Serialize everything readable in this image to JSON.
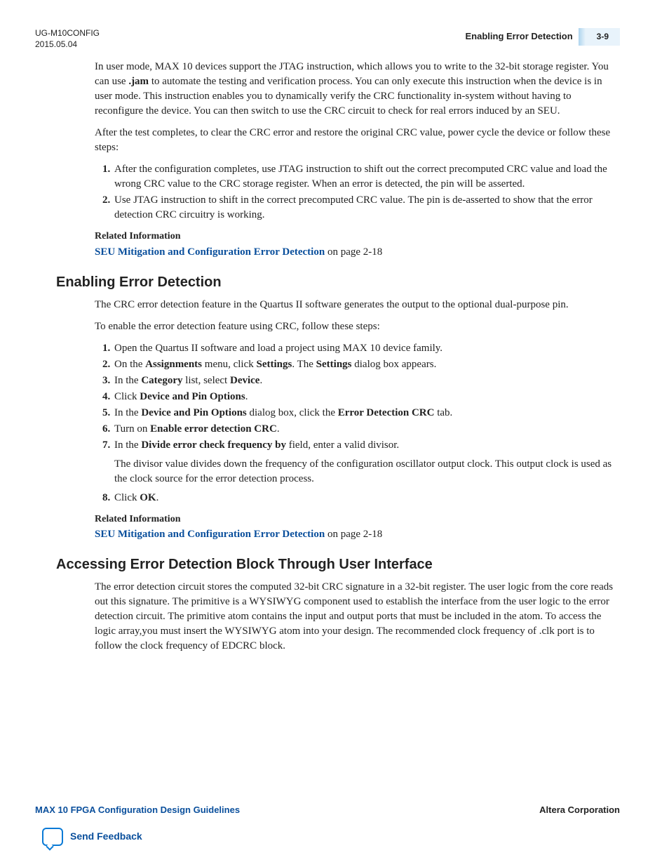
{
  "header": {
    "doc_id": "UG-M10CONFIG",
    "date": "2015.05.04",
    "page_title": "Enabling Error Detection",
    "page_number": "3-9"
  },
  "intro_para": "In user mode, MAX 10 devices support the                                   JTAG instruction, which allows you to write to the 32-bit storage register. You can use ",
  "intro_bold": ".jam",
  "intro_after": " to automate the testing and verification process. You can only execute this instruction when the device is in user mode. This instruction enables you to dynamically verify the CRC functionality in-system without having to reconfigure the device. You can then switch to use the CRC circuit to check for real errors induced by an SEU.",
  "para2": "After the test completes, to clear the CRC error and restore the original CRC value, power cycle the device or follow these steps:",
  "steps1": [
    "After the configuration completes, use                                    JTAG instruction to shift out the correct precomputed CRC value and load the wrong CRC value to the CRC storage register. When an error is detected, the                      pin will be asserted.",
    "Use                           JTAG instruction to shift in the correct precomputed CRC value. The                      pin is de-asserted to show that the error detection CRC circuitry is working."
  ],
  "related1": {
    "heading": "Related Information",
    "link": "SEU Mitigation and Configuration Error Detection",
    "suffix": " on page 2-18"
  },
  "section1": {
    "title": "Enabling Error Detection",
    "p1": "The CRC error detection feature in the Quartus II software generates the                         output to the optional dual-purpose                       pin.",
    "p2": "To enable the error detection feature using CRC, follow these steps:",
    "steps_text": {
      "s1": "Open the Quartus II software and load a project using MAX 10 device family.",
      "s2_a": "On the ",
      "s2_b": "Assignments",
      "s2_c": " menu, click ",
      "s2_d": "Settings",
      "s2_e": ". The ",
      "s2_f": "Settings",
      "s2_g": " dialog box appears.",
      "s3_a": "In the ",
      "s3_b": "Category",
      "s3_c": " list, select ",
      "s3_d": "Device",
      "s3_e": ".",
      "s4_a": "Click ",
      "s4_b": "Device and Pin Options",
      "s4_c": ".",
      "s5_a": "In the ",
      "s5_b": "Device and Pin Options",
      "s5_c": " dialog box, click the ",
      "s5_d": "Error Detection CRC",
      "s5_e": " tab.",
      "s6_a": "Turn on ",
      "s6_b": "Enable error detection CRC",
      "s6_c": ".",
      "s7_a": "In the ",
      "s7_b": "Divide error check frequency by",
      "s7_c": " field, enter a valid divisor.",
      "s7_note": "The divisor value divides down the frequency of the configuration oscillator output clock. This output clock is used as the clock source for the error detection process.",
      "s8_a": "Click ",
      "s8_b": "OK",
      "s8_c": "."
    }
  },
  "related2": {
    "heading": "Related Information",
    "link": "SEU Mitigation and Configuration Error Detection",
    "suffix": " on page 2-18"
  },
  "section2": {
    "title": "Accessing Error Detection Block Through User Interface",
    "p1": "The error detection circuit stores the computed 32-bit CRC signature in a 32-bit register. The user logic from the core reads out this signature. The                                              primitive is a WYSIWYG component used to establish the interface from the user logic to the error detection circuit. The                                                  primitive atom contains the input and output ports that must be included in the atom. To access the logic array,you must insert the                                              WYSIWYG atom into your design. The recommended clock frequency of .clk port is to follow the clock frequency of EDCRC block."
  },
  "footer": {
    "left": "MAX 10 FPGA Configuration Design Guidelines",
    "right": "Altera Corporation",
    "feedback": "Send Feedback"
  }
}
